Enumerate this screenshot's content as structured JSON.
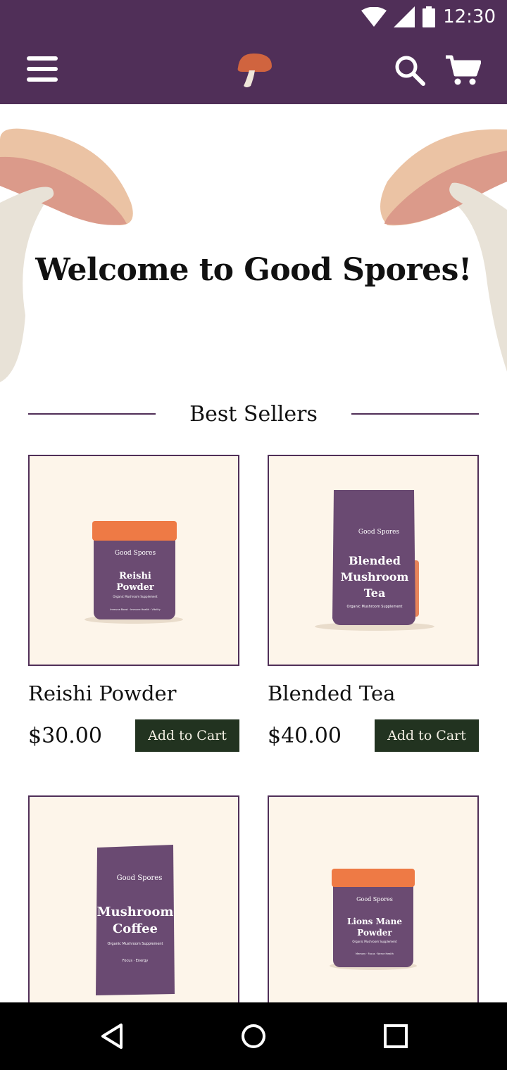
{
  "status": {
    "time": "12:30",
    "icons": [
      "wifi-icon",
      "signal-icon",
      "battery-icon"
    ]
  },
  "appbar": {
    "menu_icon": "menu-icon",
    "logo": "mushroom-logo",
    "search_icon": "search-icon",
    "cart_icon": "cart-icon",
    "bg": "#502f58"
  },
  "hero": {
    "title": "Welcome to Good Spores!"
  },
  "section": {
    "title": "Best Sellers"
  },
  "products": [
    {
      "name": "Reishi Powder",
      "price": "$30.00",
      "button": "Add to Cart",
      "package": {
        "brand": "Good Spores",
        "line1": "Reishi",
        "line2": "Powder",
        "sub": "Organic Mushroom Supplement",
        "tiny": "Immune Boost · Immune Health · Vitality"
      }
    },
    {
      "name": "Blended Tea",
      "price": "$40.00",
      "button": "Add to Cart",
      "package": {
        "brand": "Good Spores",
        "line1": "Blended",
        "line2": "Mushroom",
        "line3": "Tea",
        "sub": "Organic Mushroom Supplement"
      }
    },
    {
      "name": "Mushroom Coffee",
      "package": {
        "brand": "Good Spores",
        "line1": "Mushroom",
        "line2": "Coffee",
        "sub": "Organic Mushroom Supplement",
        "tiny": "Focus · Energy"
      }
    },
    {
      "name": "Lions Mane Powder",
      "package": {
        "brand": "Good Spores",
        "line1": "Lions Mane",
        "line2": "Powder",
        "sub": "Organic Mushroom Supplement",
        "tiny": "Memory · Focus · Nerve Health"
      }
    }
  ],
  "colors": {
    "brand_purple": "#502f58",
    "button_green": "#223320",
    "card_bg": "#fdf5ea",
    "accent_orange": "#ee7a45"
  },
  "navbar": {
    "back_icon": "back-icon",
    "home_icon": "home-icon",
    "recents_icon": "recents-icon"
  }
}
